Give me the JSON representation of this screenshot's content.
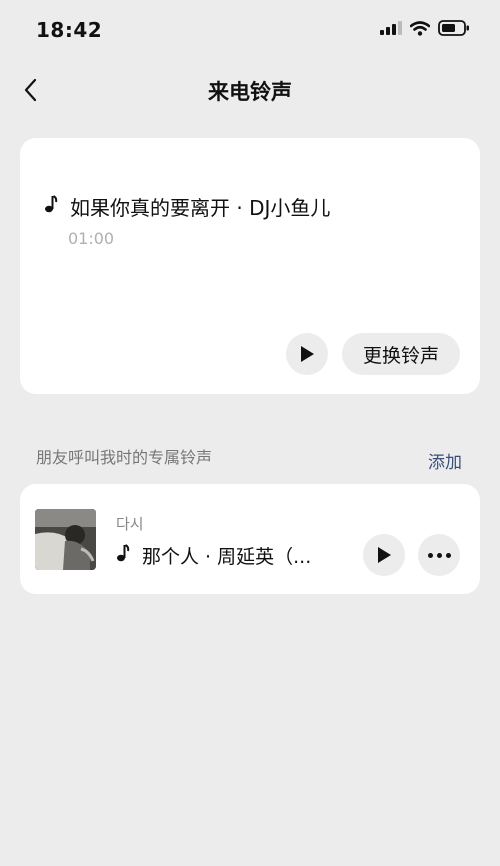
{
  "status": {
    "time": "18:42"
  },
  "nav": {
    "title": "来电铃声"
  },
  "current": {
    "song_title": "如果你真的要离开 · DJ小鱼儿",
    "duration": "01:00",
    "change_label": "更换铃声"
  },
  "friends": {
    "section_label": "朋友呼叫我时的专属铃声",
    "add_label": "添加",
    "items": [
      {
        "contact": "다시",
        "song_title": "那个人 · 周延英（..."
      }
    ]
  },
  "icons": [
    "back-chevron-icon",
    "music-note-icon",
    "play-icon",
    "more-icon",
    "signal-icon",
    "wifi-icon",
    "battery-icon"
  ]
}
